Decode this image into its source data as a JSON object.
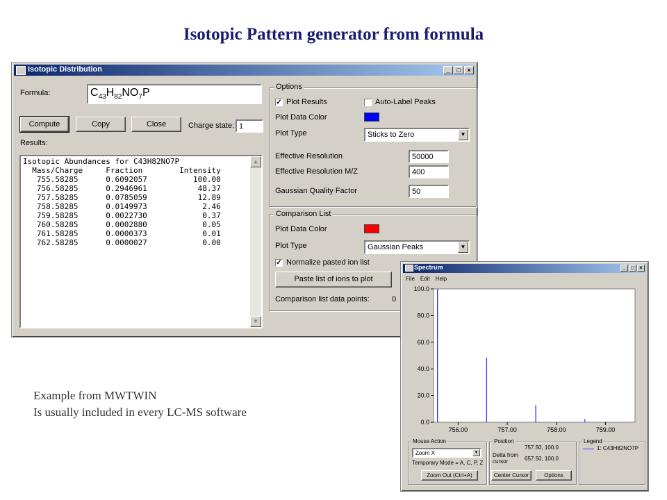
{
  "slide": {
    "title": "Isotopic Pattern generator from formula",
    "caption_line1": "Example from MWTWIN",
    "caption_line2": "Is usually included in every LC-MS software"
  },
  "iso_window": {
    "title": "Isotopic Distribution",
    "title_buttons": [
      "_",
      "□",
      "×"
    ],
    "formula_label": "Formula:",
    "formula": {
      "c": "C",
      "c_sub": "43",
      "h": "H",
      "h_sub": "82",
      "no": "NO",
      "o_sub": "7",
      "p": "P"
    },
    "compute_label": "Compute",
    "copy_label": "Copy",
    "close_label": "Close",
    "charge_label": "Charge state:",
    "charge_value": "1",
    "results_label": "Results:",
    "results_heading": "Isotopic Abundances for C43H82NO7P",
    "results_columns": [
      "Mass/Charge",
      "Fraction",
      "Intensity"
    ],
    "results_rows": [
      [
        "755.58285",
        "0.6092057",
        "100.00"
      ],
      [
        "756.58285",
        "0.2946961",
        "48.37"
      ],
      [
        "757.58285",
        "0.0785059",
        "12.89"
      ],
      [
        "758.58285",
        "0.0149973",
        "2.46"
      ],
      [
        "759.58285",
        "0.0022730",
        "0.37"
      ],
      [
        "760.58285",
        "0.0002880",
        "0.05"
      ],
      [
        "761.58285",
        "0.0000373",
        "0.01"
      ],
      [
        "762.58285",
        "0.0000027",
        "0.00"
      ]
    ],
    "options": {
      "group_title": "Options",
      "plot_results_label": "Plot Results",
      "plot_results_checked": true,
      "auto_label_label": "Auto-Label Peaks",
      "auto_label_checked": false,
      "plot_color_label": "Plot Data Color",
      "plot_color": "#0000ff",
      "plot_type_label": "Plot Type",
      "plot_type_value": "Sticks to Zero",
      "eff_res_label": "Effective Resolution",
      "eff_res_value": "50000",
      "eff_res_mz_label": "Effective Resolution M/Z",
      "eff_res_mz_value": "400",
      "gauss_label": "Gaussian Quality Factor",
      "gauss_value": "50"
    },
    "comparison": {
      "group_title": "Comparison List",
      "plot_color_label": "Plot Data Color",
      "plot_color": "#ff0000",
      "plot_type_label": "Plot Type",
      "plot_type_value": "Gaussian Peaks",
      "normalize_label": "Normalize pasted ion list",
      "normalize_checked": true,
      "paste_label": "Paste list of ions to plot",
      "points_label": "Comparison list data points:",
      "points_value": "0"
    }
  },
  "spectrum_window": {
    "title": "Spectrum",
    "menu": [
      "File",
      "Edit",
      "Help"
    ],
    "plot_color": "#3333ff",
    "mouse_action_title": "Mouse Action",
    "mouse_action_value": "Zoom X",
    "temp_mode": "Temporary Mode = A, C, P, Z",
    "zoom_out_label": "Zoom Out (Ctrl+A)",
    "position_title": "Position",
    "position_value": "757.50, 100.0",
    "delta_label": "Delta from cursor",
    "delta_value": "657.50, 100.0",
    "center_cursor_label": "Center Cursor",
    "options_label": "Options",
    "legend_title": "Legend",
    "legend_entry": "1: C43H82NO7P"
  },
  "chart_data": {
    "type": "bar",
    "title": "",
    "xlabel": "",
    "ylabel": "",
    "x_ticks": [
      "756.00",
      "757.00",
      "758.00",
      "759.00"
    ],
    "y_ticks": [
      "0.0",
      "20.0",
      "40.0",
      "60.0",
      "80.0",
      "100.0"
    ],
    "xlim": [
      755.5,
      759.6
    ],
    "ylim": [
      0,
      100
    ],
    "series": [
      {
        "name": "1: C43H82NO7P",
        "x": [
          755.58,
          756.58,
          757.58,
          758.58,
          759.58
        ],
        "values": [
          100.0,
          48.37,
          12.89,
          2.46,
          0.37
        ]
      }
    ]
  }
}
